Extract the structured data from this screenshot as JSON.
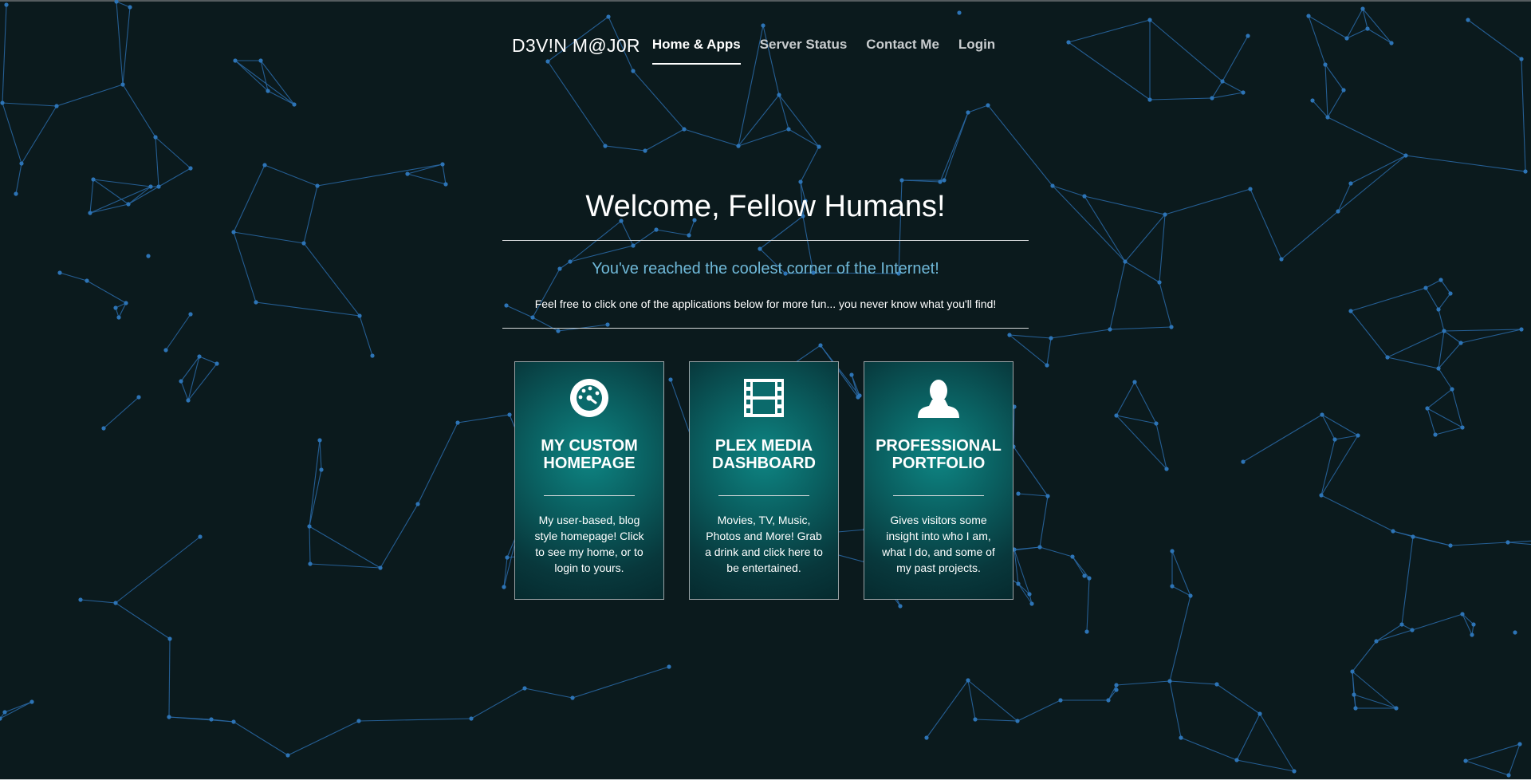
{
  "brand": "D3V!N M@J0R",
  "nav": {
    "items": [
      {
        "label": "Home & Apps",
        "active": true
      },
      {
        "label": "Server Status",
        "active": false
      },
      {
        "label": "Contact Me",
        "active": false
      },
      {
        "label": "Login",
        "active": false
      }
    ]
  },
  "hero": {
    "title": "Welcome, Fellow Humans!",
    "subtitle": "You've reached the coolest corner of the Internet!",
    "text": "Feel free to click one of the applications below for more fun... you never know what you'll find!"
  },
  "cards": [
    {
      "icon": "dashboard-icon",
      "title": "MY CUSTOM\nHOMEPAGE",
      "description": "My user-based, blog style homepage! Click to see my home, or to login to yours."
    },
    {
      "icon": "film-icon",
      "title": "PLEX MEDIA\nDASHBOARD",
      "description": "Movies, TV, Music, Photos and More! Grab a drink and click here to be entertained."
    },
    {
      "icon": "user-icon",
      "title": "PROFESSIONAL\nPORTFOLIO",
      "description": "Gives visitors some insight into who I am, what I do, and some of my past projects."
    }
  ],
  "colors": {
    "background": "#0b1a1d",
    "network": "#2a6aa8",
    "subtitle": "#6fb8d8",
    "card_glow": "#0e8583"
  }
}
